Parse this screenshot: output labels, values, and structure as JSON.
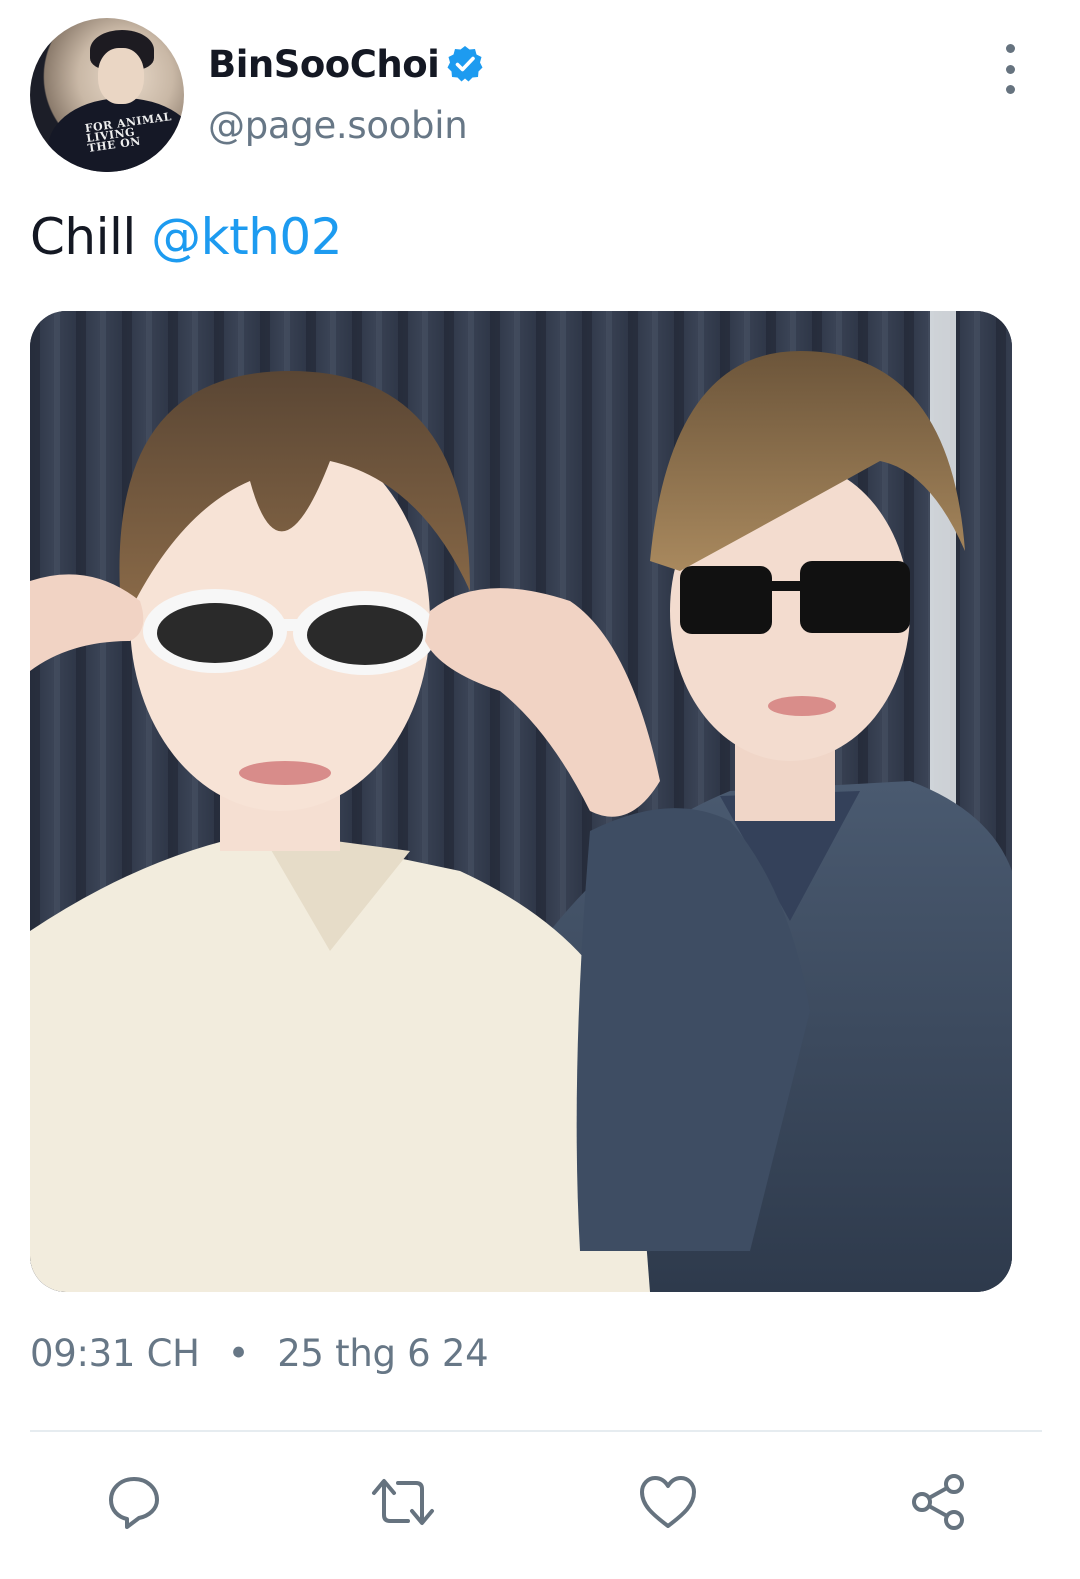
{
  "tweet": {
    "author": {
      "display_name": "BinSooChoi",
      "handle": "@page.soobin",
      "verified": true,
      "avatar_shirt_text": [
        "FOR ANIMAL",
        "LIVING",
        "THE ON"
      ]
    },
    "text": {
      "plain": "Chill ",
      "mention": "@kth02"
    },
    "time": "09:31 CH",
    "separator": "•",
    "date": "25 thg 6 24"
  },
  "icons": {
    "verified": "verified-badge-icon",
    "more": "more-options-icon",
    "reply": "reply-icon",
    "retweet": "retweet-icon",
    "like": "like-icon",
    "share": "share-icon"
  },
  "colors": {
    "accent": "#1d9bf0",
    "text_primary": "#141823",
    "text_secondary": "#677786",
    "icon": "#66737f",
    "divider": "#e6ecf0"
  }
}
